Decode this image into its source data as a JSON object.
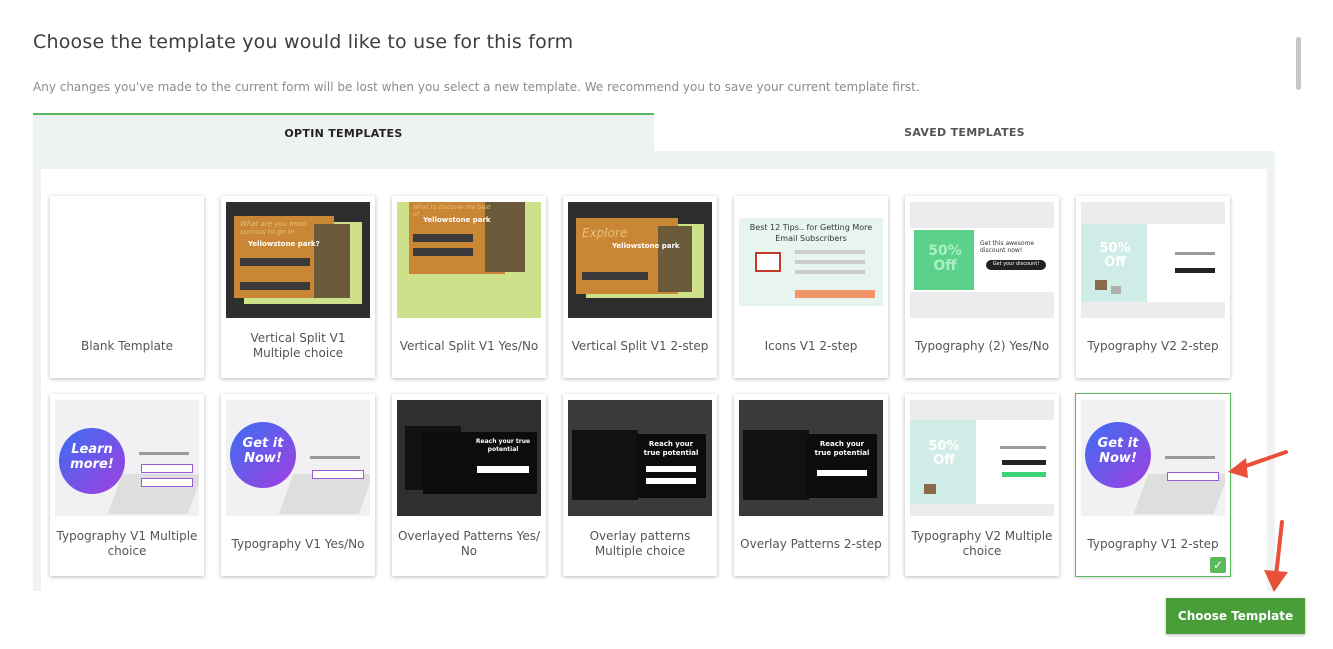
{
  "header": {
    "title": "Choose the template you would like to use for this form",
    "subtitle": "Any changes you've made to the current form will be lost when you select a new template. We recommend you to save your current template first."
  },
  "tabs": [
    {
      "label": "OPTIN TEMPLATES",
      "active": true
    },
    {
      "label": "SAVED TEMPLATES",
      "active": false
    }
  ],
  "templates": [
    {
      "label": "Blank Template"
    },
    {
      "label": "Vertical Split V1 Multiple choice",
      "thumb_heading": "What are you most curious to go in",
      "thumb_title": "Yellowstone park?"
    },
    {
      "label": "Vertical Split V1 Yes/No",
      "thumb_heading": "What to discover the best of",
      "thumb_title": "Yellowstone park"
    },
    {
      "label": "Vertical Split V1 2-step",
      "thumb_heading": "Explore",
      "thumb_title": "Yellowstone park"
    },
    {
      "label": "Icons V1 2-step",
      "thumb_heading": "Best 12 Tips.. for Getting More Email Subscribers"
    },
    {
      "label": "Typography (2) Yes/No",
      "thumb_text": "Get this awesome discount now!",
      "thumb_button": "Get your discount!",
      "thumb_badge": "50% Off"
    },
    {
      "label": "Typography V2 2-step",
      "thumb_badge": "50% Off"
    },
    {
      "label": "Typography V1 Multiple choice",
      "thumb_badge": "Learn more!"
    },
    {
      "label": "Typography V1 Yes/No",
      "thumb_badge": "Get it Now!"
    },
    {
      "label": "Overlayed Patterns Yes/ No",
      "thumb_heading": "Reach your true potential"
    },
    {
      "label": "Overlay patterns Multiple choice",
      "thumb_heading": "Reach your true potential"
    },
    {
      "label": "Overlay Patterns 2-step",
      "thumb_heading": "Reach your true potential"
    },
    {
      "label": "Typography V2 Multiple choice",
      "thumb_badge": "50% Off"
    },
    {
      "label": "Typography V1 2-step",
      "thumb_badge": "Get it Now!",
      "selected": true
    }
  ],
  "actions": {
    "choose_label": "Choose Template"
  },
  "colors": {
    "accent": "#4a9e3a",
    "selected_border": "#5cb85c",
    "annotation_arrow": "#e8503a"
  },
  "icons": {
    "check": "✓"
  }
}
